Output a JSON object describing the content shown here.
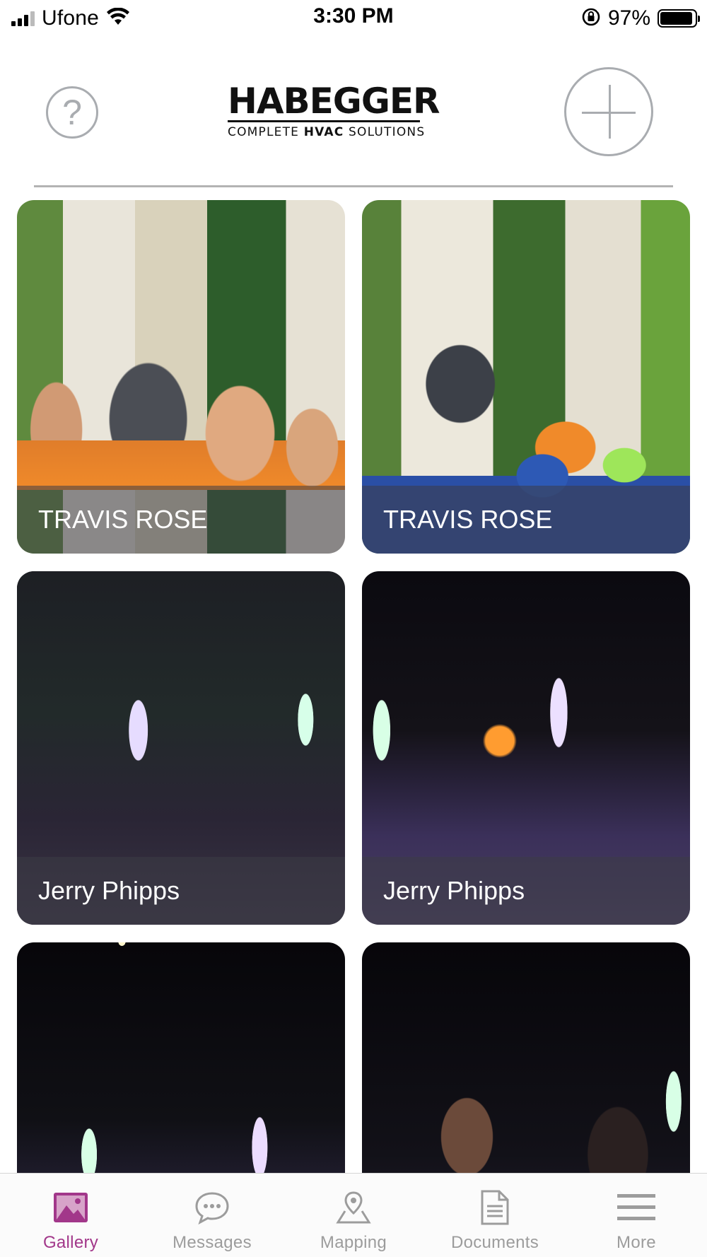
{
  "status_bar": {
    "carrier": "Ufone",
    "time": "3:30 PM",
    "battery": "97%"
  },
  "header": {
    "help_symbol": "?",
    "logo": {
      "name": "HABEGGER",
      "tagline_pre": "COMPLETE ",
      "tagline_bold": "HVAC",
      "tagline_post": " SOLUTIONS"
    },
    "add_icon": "plus-icon"
  },
  "gallery": {
    "items": [
      {
        "caption": "TRAVIS ROSE"
      },
      {
        "caption": "TRAVIS ROSE"
      },
      {
        "caption": "Jerry Phipps"
      },
      {
        "caption": "Jerry Phipps"
      },
      {
        "caption": ""
      },
      {
        "caption": ""
      }
    ]
  },
  "tab_bar": {
    "active_color": "#a2378a",
    "inactive_color": "#9c9c9c",
    "tabs": [
      {
        "label": "Gallery",
        "icon": "image-icon",
        "active": true
      },
      {
        "label": "Messages",
        "icon": "chat-bubble-icon",
        "active": false
      },
      {
        "label": "Mapping",
        "icon": "map-pin-icon",
        "active": false
      },
      {
        "label": "Documents",
        "icon": "document-icon",
        "active": false
      },
      {
        "label": "More",
        "icon": "menu-icon",
        "active": false
      }
    ]
  }
}
